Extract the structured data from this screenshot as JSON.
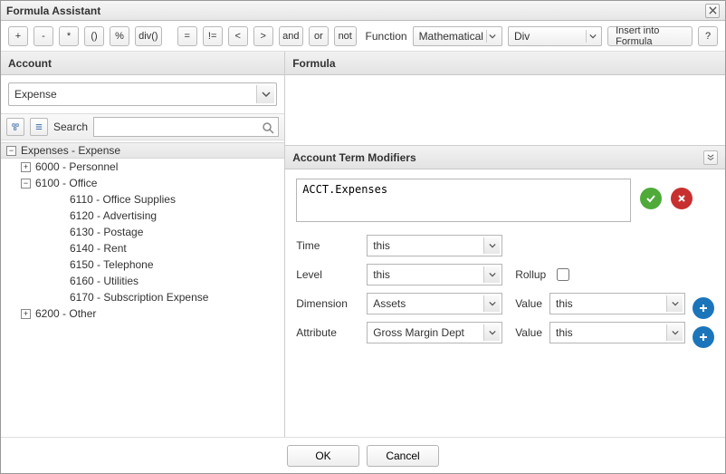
{
  "window": {
    "title": "Formula Assistant"
  },
  "toolbar": {
    "plus": "+",
    "minus": "-",
    "star": "*",
    "paren": "()",
    "percent": "%",
    "div_fn": "div()",
    "eq": "=",
    "neq": "!=",
    "lt": "<",
    "gt": ">",
    "and": "and",
    "or": "or",
    "not": "not",
    "function_label": "Function",
    "function_category": "Mathematical",
    "function_selected": "Div",
    "insert": "Insert into Formula",
    "help": "?"
  },
  "account_panel": {
    "title": "Account",
    "selected": "Expense",
    "search_label": "Search",
    "search_value": ""
  },
  "tree": {
    "root": "Expenses - Expense",
    "nodes": [
      {
        "label": "6000 - Personnel",
        "expandable": true,
        "expanded": false,
        "indent": 1
      },
      {
        "label": "6100 - Office",
        "expandable": true,
        "expanded": true,
        "indent": 1
      },
      {
        "label": "6110 - Office Supplies",
        "expandable": false,
        "indent": 3
      },
      {
        "label": "6120 - Advertising",
        "expandable": false,
        "indent": 3
      },
      {
        "label": "6130 - Postage",
        "expandable": false,
        "indent": 3
      },
      {
        "label": "6140 - Rent",
        "expandable": false,
        "indent": 3
      },
      {
        "label": "6150 - Telephone",
        "expandable": false,
        "indent": 3
      },
      {
        "label": "6160 - Utilities",
        "expandable": false,
        "indent": 3
      },
      {
        "label": "6170 - Subscription Expense",
        "expandable": false,
        "indent": 3
      },
      {
        "label": "6200 - Other",
        "expandable": true,
        "expanded": false,
        "indent": 1
      }
    ]
  },
  "formula_panel": {
    "title": "Formula"
  },
  "modifiers": {
    "title": "Account Term Modifiers",
    "term_value": "ACCT.Expenses",
    "time_label": "Time",
    "time_value": "this",
    "level_label": "Level",
    "level_value": "this",
    "rollup_label": "Rollup",
    "rollup_checked": false,
    "dimension_label": "Dimension",
    "dimension_value": "Assets",
    "dimension_value_label": "Value",
    "dimension_value_value": "this",
    "attribute_label": "Attribute",
    "attribute_value": "Gross Margin Dept",
    "attribute_value_label": "Value",
    "attribute_value_value": "this"
  },
  "footer": {
    "ok": "OK",
    "cancel": "Cancel"
  }
}
